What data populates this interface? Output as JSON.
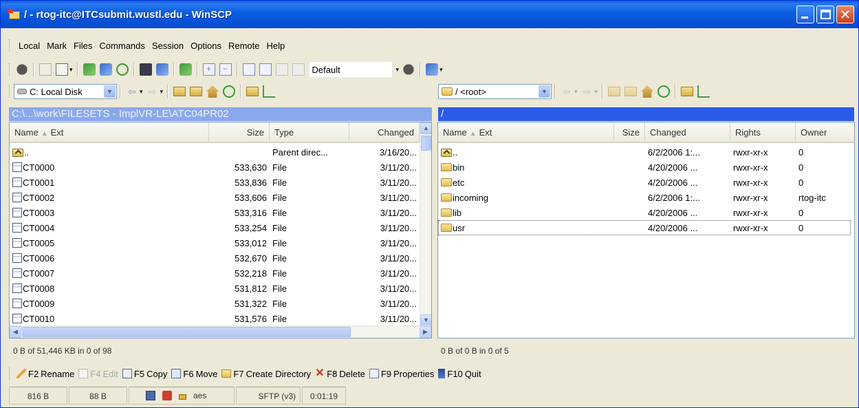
{
  "window": {
    "title": "/ - rtog-itc@ITCsubmit.wustl.edu - WinSCP"
  },
  "menu": [
    "Local",
    "Mark",
    "Files",
    "Commands",
    "Session",
    "Options",
    "Remote",
    "Help"
  ],
  "toolbar": {
    "preset_value": "Default"
  },
  "left_panel": {
    "drive": "C: Local Disk",
    "path": "C:\\...\\work\\FILESETS - ImplVR-LE\\ATC04PR02",
    "columns": [
      "Name",
      "Ext",
      "Size",
      "Type",
      "Changed"
    ],
    "rows": [
      {
        "name": "..",
        "size": "",
        "type": "Parent direc...",
        "changed": "3/16/20...",
        "icon": "parent-dir-icon"
      },
      {
        "name": "CT0000",
        "size": "533,630",
        "type": "File",
        "changed": "3/11/20...",
        "icon": "file-icon"
      },
      {
        "name": "CT0001",
        "size": "533,836",
        "type": "File",
        "changed": "3/11/20...",
        "icon": "file-icon"
      },
      {
        "name": "CT0002",
        "size": "533,606",
        "type": "File",
        "changed": "3/11/20...",
        "icon": "file-icon"
      },
      {
        "name": "CT0003",
        "size": "533,316",
        "type": "File",
        "changed": "3/11/20...",
        "icon": "file-icon"
      },
      {
        "name": "CT0004",
        "size": "533,254",
        "type": "File",
        "changed": "3/11/20...",
        "icon": "file-icon"
      },
      {
        "name": "CT0005",
        "size": "533,012",
        "type": "File",
        "changed": "3/11/20...",
        "icon": "file-icon"
      },
      {
        "name": "CT0006",
        "size": "532,670",
        "type": "File",
        "changed": "3/11/20...",
        "icon": "file-icon"
      },
      {
        "name": "CT0007",
        "size": "532,218",
        "type": "File",
        "changed": "3/11/20...",
        "icon": "file-icon"
      },
      {
        "name": "CT0008",
        "size": "531,812",
        "type": "File",
        "changed": "3/11/20...",
        "icon": "file-icon"
      },
      {
        "name": "CT0009",
        "size": "531,322",
        "type": "File",
        "changed": "3/11/20...",
        "icon": "file-icon"
      },
      {
        "name": "CT0010",
        "size": "531,576",
        "type": "File",
        "changed": "3/11/20...",
        "icon": "file-icon"
      }
    ],
    "status": "0 B of 51,446 KB in 0 of 98"
  },
  "right_panel": {
    "location": "/ <root>",
    "path": "/",
    "columns": [
      "Name",
      "Ext",
      "Size",
      "Changed",
      "Rights",
      "Owner"
    ],
    "rows": [
      {
        "name": "..",
        "size": "",
        "changed": "6/2/2006 1:...",
        "rights": "rwxr-xr-x",
        "owner": "0",
        "icon": "parent-dir-icon"
      },
      {
        "name": "bin",
        "size": "",
        "changed": "4/20/2006 ...",
        "rights": "rwxr-xr-x",
        "owner": "0",
        "icon": "folder-icon"
      },
      {
        "name": "etc",
        "size": "",
        "changed": "4/20/2006 ...",
        "rights": "rwxr-xr-x",
        "owner": "0",
        "icon": "folder-icon"
      },
      {
        "name": "incoming",
        "size": "",
        "changed": "6/2/2006 1:...",
        "rights": "rwxr-xr-x",
        "owner": "rtog-itc",
        "icon": "folder-icon"
      },
      {
        "name": "lib",
        "size": "",
        "changed": "4/20/2006 ...",
        "rights": "rwxr-xr-x",
        "owner": "0",
        "icon": "folder-icon"
      },
      {
        "name": "usr",
        "size": "",
        "changed": "4/20/2006 ...",
        "rights": "rwxr-xr-x",
        "owner": "0",
        "icon": "folder-icon"
      }
    ],
    "status": "0 B of 0 B in 0 of 5"
  },
  "commands": [
    {
      "key": "F2",
      "label": "Rename",
      "enabled": true
    },
    {
      "key": "F4",
      "label": "Edit",
      "enabled": false
    },
    {
      "key": "F5",
      "label": "Copy",
      "enabled": true
    },
    {
      "key": "F6",
      "label": "Move",
      "enabled": true
    },
    {
      "key": "F7",
      "label": "Create Directory",
      "enabled": true
    },
    {
      "key": "F8",
      "label": "Delete",
      "enabled": true
    },
    {
      "key": "F9",
      "label": "Properties",
      "enabled": true
    },
    {
      "key": "F10",
      "label": "Quit",
      "enabled": true
    }
  ],
  "statusbar": {
    "bytes_sent": "816 B",
    "bytes_received": "88 B",
    "cipher": "aes",
    "protocol": "SFTP (v3)",
    "elapsed": "0:01:19"
  },
  "colors": {
    "title_bar": "#0a5de0",
    "active_path": "#2a5ce8",
    "inactive_path": "#8aa8ec",
    "window_face": "#ece9d8"
  }
}
